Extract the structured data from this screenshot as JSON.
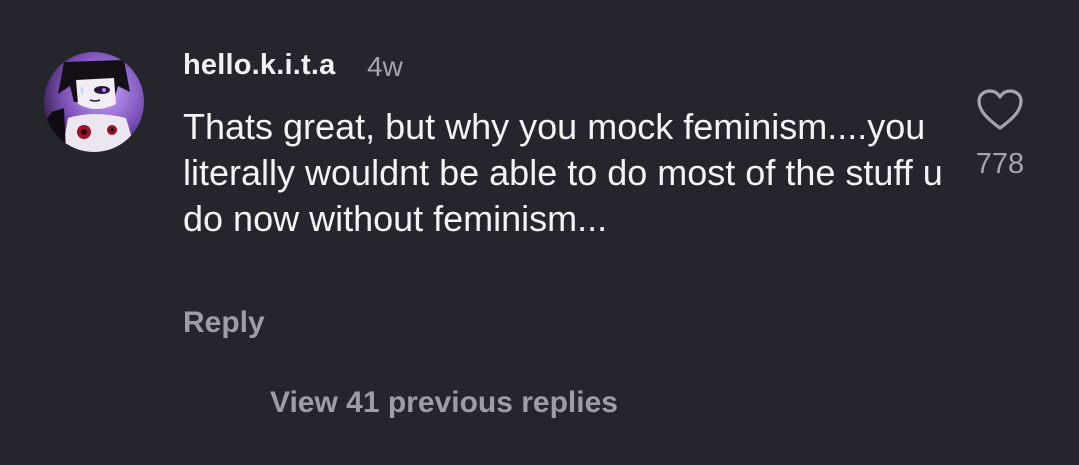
{
  "comment": {
    "username": "hello.k.i.t.a",
    "timestamp": "4w",
    "text": "Thats great, but why you mock feminism....you literally wouldnt be able to do most of the stuff u do now without feminism...",
    "reply_label": "Reply",
    "like_count": "778",
    "like_icon": "heart-outline-icon",
    "avatar_icon": "avatar"
  },
  "thread": {
    "view_replies_label": "View 41 previous replies"
  },
  "colors": {
    "background": "#25262d",
    "primary_text": "#f4f4f6",
    "secondary_text": "#a4a6ae"
  }
}
